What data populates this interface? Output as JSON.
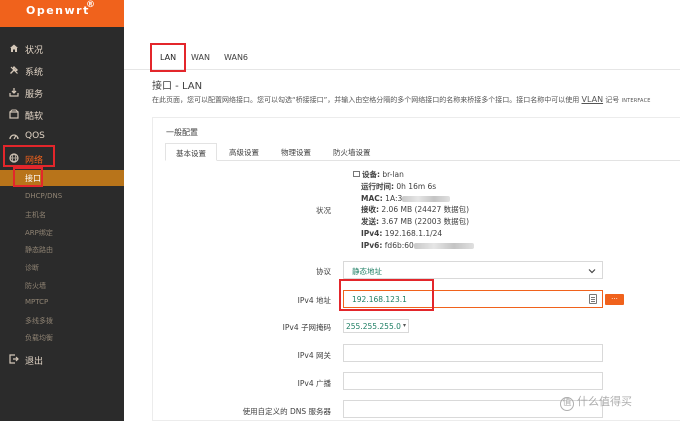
{
  "brand": {
    "name": "Openwrt",
    "reg": "®"
  },
  "sidebar": {
    "items": [
      {
        "label": "状况",
        "icon": "home-icon"
      },
      {
        "label": "系统",
        "icon": "wrench-icon"
      },
      {
        "label": "服务",
        "icon": "download-icon"
      },
      {
        "label": "酷软",
        "icon": "box-icon"
      },
      {
        "label": "QOS",
        "icon": "gauge-icon"
      },
      {
        "label": "网络",
        "icon": "globe-icon"
      }
    ],
    "network_sub": [
      "接口",
      "DHCP/DNS",
      "主机名",
      "ARP绑定",
      "静态路由",
      "诊断",
      "防火墙",
      "MPTCP",
      "多线多拨",
      "负载均衡"
    ],
    "logout": {
      "label": "退出",
      "icon": "logout-icon"
    }
  },
  "tabs": [
    "LAN",
    "WAN",
    "WAN6"
  ],
  "page": {
    "title": "接口 - LAN",
    "desc": "在此页面，您可以配置网络接口。您可以勾选“桥接接口”，并输入由空格分隔的多个网络接口的名称来桥接多个接口。接口名称中可以使用 ",
    "vlan": "VLAN",
    "desc_tail": " 记号 ",
    "iface_token": "INTERFACE"
  },
  "config": {
    "section_title": "一般配置",
    "subtabs": [
      "基本设置",
      "高级设置",
      "物理设置",
      "防火墙设置"
    ],
    "status_label": "状况",
    "status": {
      "device_label": "设备:",
      "device": "br-lan",
      "uptime_label": "运行时间:",
      "uptime": "0h 16m 6s",
      "mac_label": "MAC:",
      "mac": "1A:3",
      "rx_label": "接收:",
      "rx": "2.06 MB (24427 数据包)",
      "tx_label": "发送:",
      "tx": "3.67 MB (22003 数据包)",
      "ipv4_label": "IPv4:",
      "ipv4": "192.168.1.1/24",
      "ipv6_label": "IPv6:",
      "ipv6": "fd6b:60"
    },
    "protocol_label": "协议",
    "protocol_value": "静态地址",
    "ipv4_addr_label": "IPv4 地址",
    "ipv4_addr_value": "192.168.123.1",
    "ipv4_mask_label": "IPv4 子网掩码",
    "ipv4_mask_value": "255.255.255.0",
    "ipv4_gw_label": "IPv4 网关",
    "ipv4_bcast_label": "IPv4 广播",
    "dns_label": "使用自定义的 DNS 服务器",
    "more_button": "..."
  },
  "watermark": {
    "text": "什么值得买",
    "glyph": "值"
  }
}
